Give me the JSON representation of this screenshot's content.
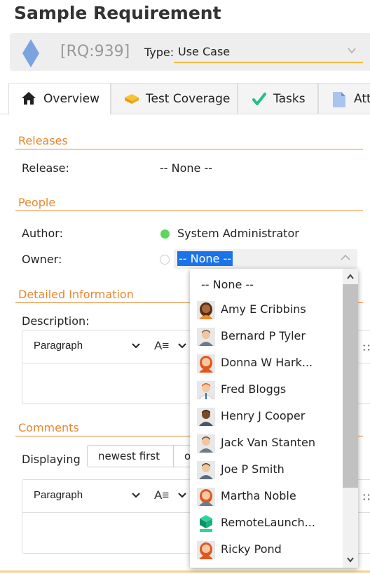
{
  "page": {
    "title": "Sample Requirement"
  },
  "header": {
    "requirement_id": "[RQ:939]",
    "type_label": "Type:",
    "type_value": "Use Case"
  },
  "tabs": [
    {
      "label": "Overview",
      "icon": "home-icon"
    },
    {
      "label": "Test Coverage",
      "icon": "test-coverage-icon"
    },
    {
      "label": "Tasks",
      "icon": "checkmark-icon"
    },
    {
      "label": "Att",
      "icon": "document-icon"
    }
  ],
  "releases": {
    "section_title": "Releases",
    "release_label": "Release:",
    "release_value": "-- None --"
  },
  "people": {
    "section_title": "People",
    "author_label": "Author:",
    "author_value": "System Administrator",
    "owner_label": "Owner:",
    "owner_value": "-- None --"
  },
  "detailed": {
    "section_title": "Detailed Information",
    "description_label": "Description:",
    "toolbar_paragraph": "Paragraph"
  },
  "comments": {
    "section_title": "Comments",
    "displaying_label": "Displaying",
    "newest_first": "newest first",
    "other_partial": "o",
    "toolbar_paragraph": "Paragraph"
  },
  "owner_dropdown": {
    "options": [
      {
        "label": "-- None --",
        "avatar": "none"
      },
      {
        "label": "Amy E Cribbins",
        "avatar": "female-dark-avatar"
      },
      {
        "label": "Bernard P Tyler",
        "avatar": "male-avatar"
      },
      {
        "label": "Donna W Hark...",
        "avatar": "female-redhead-avatar"
      },
      {
        "label": "Fred Bloggs",
        "avatar": "male-redhead-avatar"
      },
      {
        "label": "Henry J Cooper",
        "avatar": "male-dark-avatar"
      },
      {
        "label": "Jack Van Stanten",
        "avatar": "male-avatar"
      },
      {
        "label": "Joe P Smith",
        "avatar": "male-avatar"
      },
      {
        "label": "Martha Noble",
        "avatar": "female-redhead-avatar"
      },
      {
        "label": "RemoteLaunch...",
        "avatar": "robot-avatar"
      },
      {
        "label": "Ricky Pond",
        "avatar": "female-redhead-avatar"
      }
    ]
  },
  "colors": {
    "accent_orange": "#e8872f",
    "type_underline": "#f4b942",
    "status_online": "#5cd65c",
    "selection_blue": "#1a73e8"
  }
}
